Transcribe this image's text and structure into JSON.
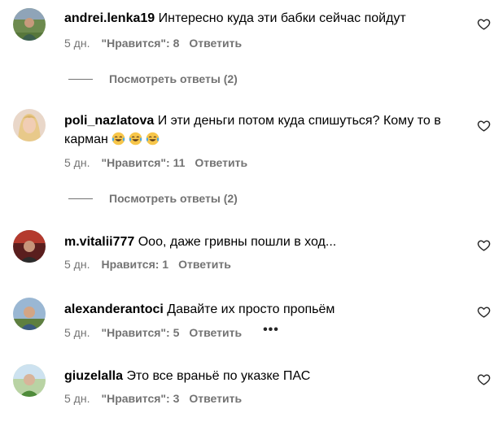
{
  "comments": [
    {
      "username": "andrei.lenka19",
      "text": "Интересно куда эти бабки сейчас пойдут",
      "time": "5 дн.",
      "likes": "\"Нравится\": 8",
      "reply": "Ответить",
      "view_replies": "Посмотреть ответы (2)"
    },
    {
      "username": "poli_nazlatova",
      "text": "И эти деньги потом куда спишуться? Кому то в карман",
      "emoji": [
        "face-with-tears-of-joy",
        "face-with-tears-of-joy",
        "face-with-tears-of-joy"
      ],
      "time": "5 дн.",
      "likes": "\"Нравится\": 11",
      "reply": "Ответить",
      "view_replies": "Посмотреть ответы (2)"
    },
    {
      "username": "m.vitalii777",
      "text": "Ооо, даже гривны пошли в ход...",
      "time": "5 дн.",
      "likes": "Нравится: 1",
      "reply": "Ответить"
    },
    {
      "username": "alexanderantoci",
      "text": "Давайте их просто пропьём",
      "time": "5 дн.",
      "likes": "\"Нравится\": 5",
      "reply": "Ответить",
      "more": "•••"
    },
    {
      "username": "giuzelalla",
      "text": "Это все враньё по указке ПАС",
      "time": "5 дн.",
      "likes": "\"Нравится\": 3",
      "reply": "Ответить"
    }
  ],
  "icons": {
    "like": "heart-outline-icon",
    "emoji": "face-with-tears-of-joy-emoji",
    "more": "more-options-icon"
  },
  "colors": {
    "text": "#000000",
    "secondary": "#737373",
    "background": "#ffffff"
  }
}
